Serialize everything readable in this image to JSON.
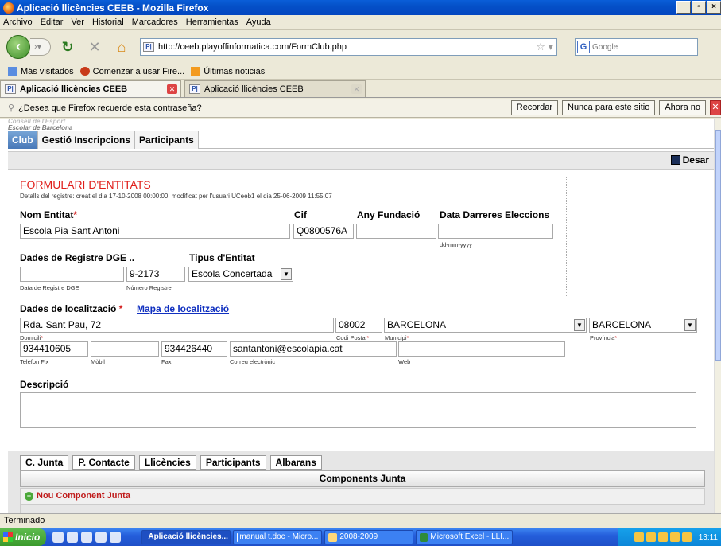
{
  "window": {
    "title": "Aplicació llicències CEEB - Mozilla Firefox",
    "buttons": [
      "_",
      "▫",
      "×"
    ]
  },
  "menu": [
    "Archivo",
    "Editar",
    "Ver",
    "Historial",
    "Marcadores",
    "Herramientas",
    "Ayuda"
  ],
  "nav": {
    "url": "http://ceeb.playoffinformatica.com/FormClub.php",
    "favicon": "P|",
    "search_placeholder": "Google"
  },
  "bookmarks": [
    "Más visitados",
    "Comenzar a usar Fire...",
    "Últimas noticias"
  ],
  "tabs": [
    {
      "label": "Aplicació llicències CEEB",
      "active": true
    },
    {
      "label": "Aplicació llicències CEEB",
      "active": false
    }
  ],
  "password_bar": {
    "message": "¿Desea que Firefox recuerde esta contraseña?",
    "remember": "Recordar",
    "never": "Nunca para este sitio",
    "not_now": "Ahora no"
  },
  "page": {
    "logo_line1": "Consell de l'Esport",
    "logo_line2": "Escolar de Barcelona",
    "app_tabs": [
      "Club",
      "Gestió Inscripcions",
      "Participants"
    ],
    "save_label": "Desar",
    "form_title": "FORMULARI D'ENTITATS",
    "details": "Detalls del registre: creat el dia 17-10-2008 00:00:00, modificat per l'usuari UCeeb1 el dia 25-06-2009 11:55:07",
    "labels": {
      "nom_entitat": "Nom Entitat",
      "cif": "Cif",
      "any_fundacio": "Any Fundació",
      "data_eleccions": "Data Darreres Eleccions",
      "dades_registre": "Dades de Registre DGE ..",
      "tipus_entitat": "Tipus d'Entitat",
      "dades_localitzacio": "Dades de localització",
      "mapa": "Mapa de localització",
      "descripcio": "Descripció"
    },
    "required_mark": "*",
    "values": {
      "nom_entitat": "Escola Pia Sant Antoni",
      "cif": "Q0800576A",
      "any_fundacio": "",
      "data_eleccions": "",
      "data_registre": "",
      "numero_registre": "9-2173",
      "tipus_entitat": "Escola Concertada",
      "domicili": "Rda. Sant Pau, 72",
      "codi_postal": "08002",
      "municipi": "BARCELONA",
      "provincia": "BARCELONA",
      "telefon_fix": "934410605",
      "mobil": "",
      "fax": "934426440",
      "correu": "santantoni@escolapia.cat",
      "web": ""
    },
    "hints": {
      "date_format": "dd-mm-yyyy",
      "data_registre": "Data de Registre DGE",
      "numero_registre": "Número Registre",
      "domicili": "Domicili",
      "codi_postal": "Codi Postal",
      "municipi": "Municipi",
      "provincia": "Província",
      "telefon_fix": "Telèfon Fix",
      "mobil": "Mòbil",
      "fax": "Fax",
      "correu": "Correu electrònic",
      "web": "Web"
    },
    "sub_tabs": [
      "C. Junta",
      "P. Contacte",
      "Llicències",
      "Participants",
      "Albarans"
    ],
    "components_header": "Components Junta",
    "new_component": "Nou Component Junta"
  },
  "status": "Terminado",
  "taskbar": {
    "start": "Inicio",
    "tasks": [
      {
        "label": "Aplicació llicències...",
        "active": true
      },
      {
        "label": "manual t.doc - Micro...",
        "active": false
      },
      {
        "label": "2008-2009",
        "active": false
      },
      {
        "label": "Microsoft Excel - LLI...",
        "active": false
      }
    ],
    "clock": "13:11"
  },
  "colors": {
    "accent_red": "#e0201c",
    "link_blue": "#1030c0",
    "title_blue": "#0450c8"
  }
}
